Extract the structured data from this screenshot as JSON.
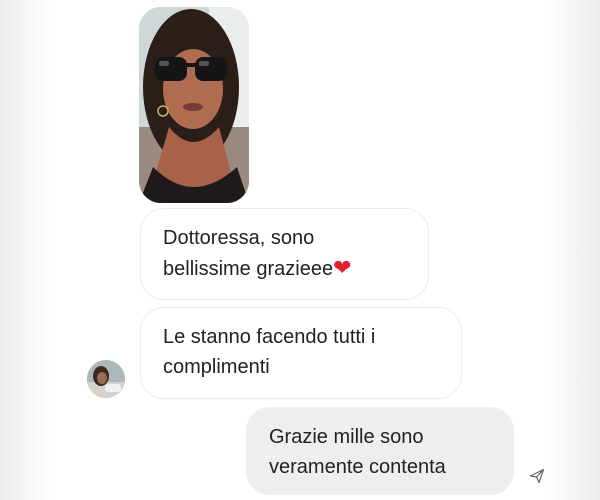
{
  "conversation": {
    "messages": [
      {
        "type": "image",
        "direction": "incoming",
        "icon": "photo-of-woman-with-sunglasses"
      },
      {
        "type": "text",
        "direction": "incoming",
        "lines": [
          "Dottoressa, sono",
          "bellissime grazieee"
        ],
        "emoji": "❤"
      },
      {
        "type": "text",
        "direction": "incoming",
        "lines": [
          "Le stanno facendo tutti i",
          "complimenti"
        ]
      },
      {
        "type": "text",
        "direction": "outgoing",
        "lines": [
          "Grazie mille sono",
          "veramente contenta"
        ]
      }
    ],
    "avatar_icon": "contact-avatar",
    "status_icon": "sent-paper-plane-icon"
  },
  "colors": {
    "incoming_bubble": "#ffffff",
    "outgoing_bubble": "#eeeeee",
    "heart": "#e0202a",
    "text": "#222222"
  }
}
